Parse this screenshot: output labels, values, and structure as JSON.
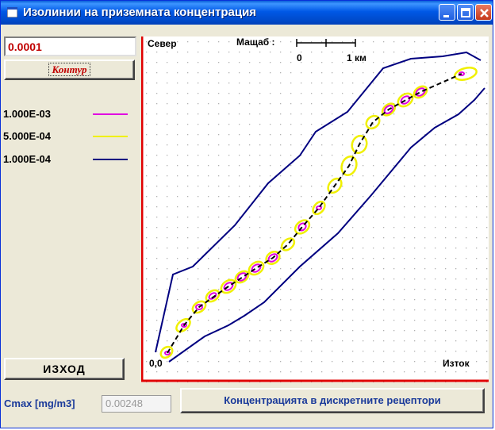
{
  "window": {
    "title": "Изолинии на приземната концентрация"
  },
  "left_panel": {
    "value_field": "0.0001",
    "contour_button": "Контур",
    "legend": [
      {
        "value": "1.000E-03",
        "color": "#e000e0"
      },
      {
        "value": "5.000E-04",
        "color": "#f0f000"
      },
      {
        "value": "1.000E-04",
        "color": "#000080"
      }
    ],
    "exit_button": "ИЗХОД"
  },
  "bottom": {
    "cmax_label": "Cmax [mg/m3]",
    "cmax_value": "0.00248",
    "receptors_button": "Концентрацията в дискретните рецептори"
  },
  "plot": {
    "north_label": "Север",
    "scale_label": "Мащаб :",
    "scale_ticks": [
      "0",
      "1 км"
    ],
    "origin_label": "0,0",
    "east_label": "Изток",
    "colors": {
      "border": "#e00000",
      "grid_dot": "#b0b0b0",
      "path": "#000000"
    }
  }
}
